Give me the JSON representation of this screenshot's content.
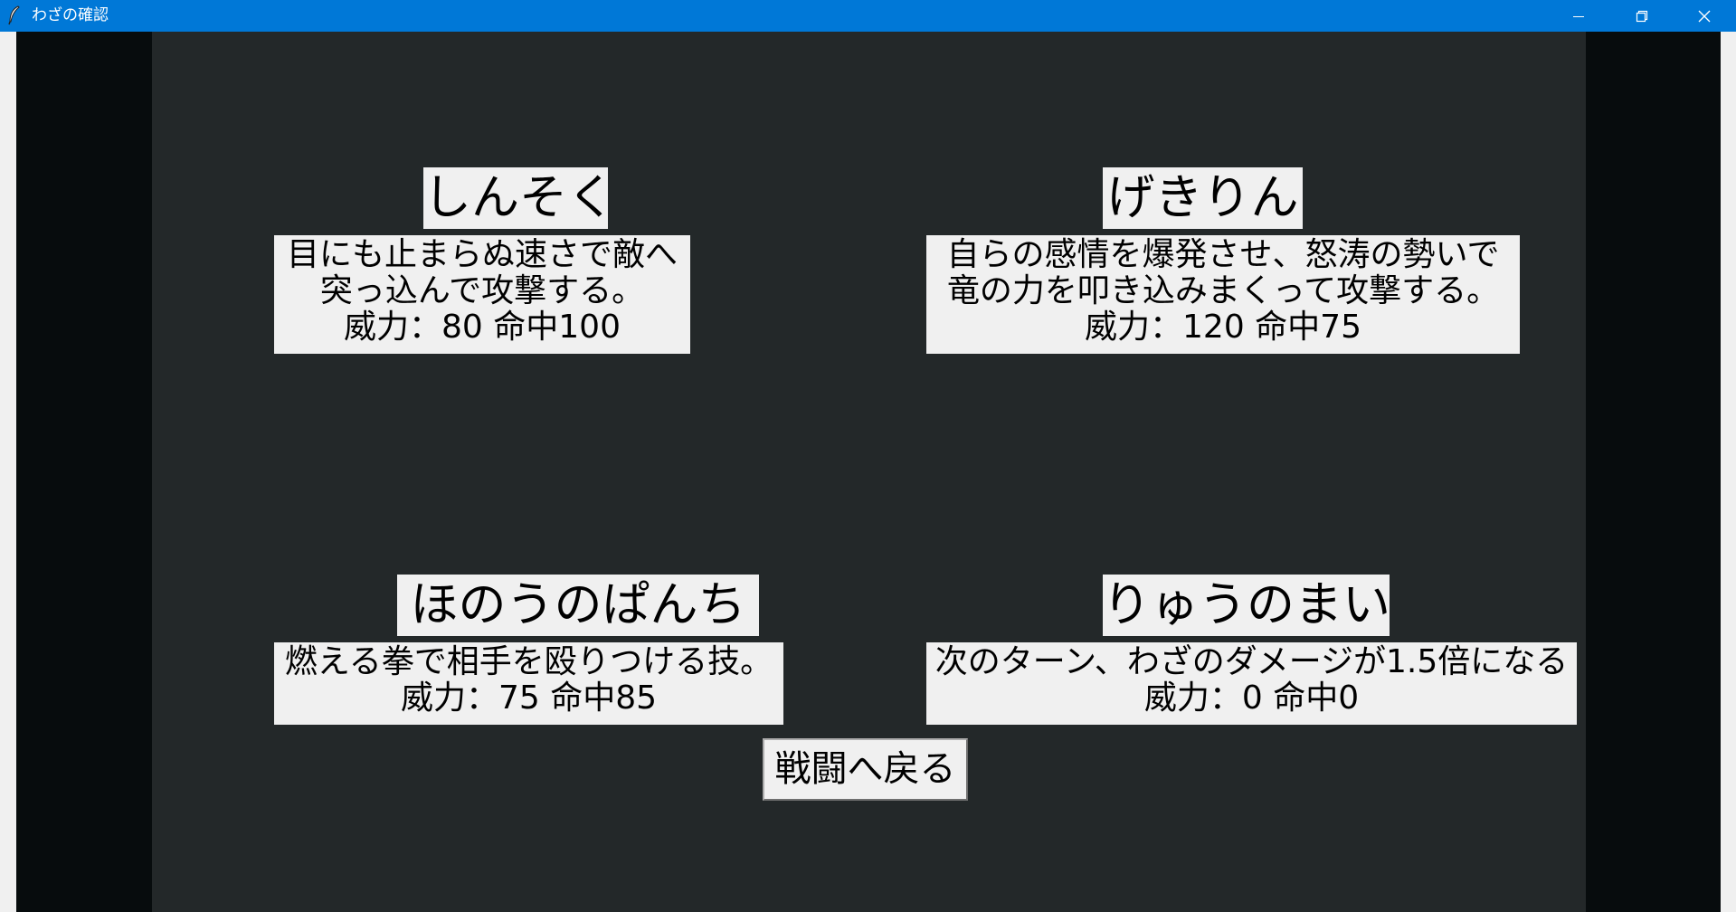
{
  "window": {
    "title": "わざの確認",
    "titlebar_color": "#0078d7",
    "icon": "feather-icon",
    "controls": [
      "minimize-icon",
      "restore-icon",
      "close-icon"
    ]
  },
  "moves": [
    {
      "name": "しんそく",
      "description_lines": [
        "目にも止まらぬ速さで敵へ",
        "突っ込んで攻撃する。"
      ],
      "stats": "威力：80 命中100"
    },
    {
      "name": "げきりん",
      "description_lines": [
        "自らの感情を爆発させ、怒涛の勢いで",
        "竜の力を叩き込みまくって攻撃する。"
      ],
      "stats": "威力：120 命中75"
    },
    {
      "name": "ほのうのぱんち",
      "description_lines": [
        "燃える拳で相手を殴りつける技。"
      ],
      "stats": "威力：75 命中85"
    },
    {
      "name": "りゅうのまい",
      "description_lines": [
        "次のターン、わざのダメージが1.5倍になる"
      ],
      "stats": "威力：0 命中0"
    }
  ],
  "back_button": {
    "label": "戦闘へ戻る"
  },
  "colors": {
    "outer_background": "#070c0d",
    "panel_background": "#232829",
    "label_background": "#f0f0f0"
  }
}
